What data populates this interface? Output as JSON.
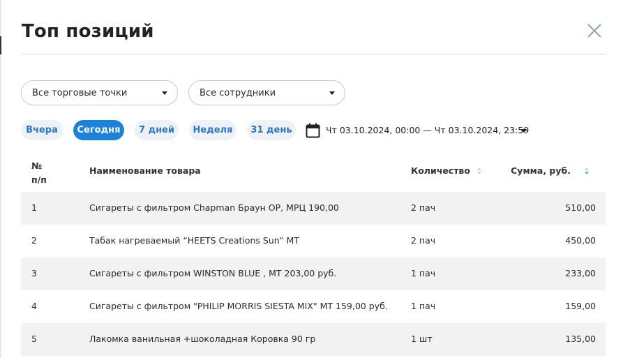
{
  "modal": {
    "title": "Топ позиций"
  },
  "filters": {
    "points_select": "Все торговые точки",
    "staff_select": "Все сотрудники"
  },
  "periods": [
    {
      "label": "Вчера",
      "active": false
    },
    {
      "label": "Сегодня",
      "active": true
    },
    {
      "label": "7 дней",
      "active": false
    },
    {
      "label": "Неделя",
      "active": false
    },
    {
      "label": "31 день",
      "active": false
    }
  ],
  "date_range": {
    "text": "Чт 03.10.2024, 00:00 — Чт 03.10.2024, 23:59"
  },
  "table": {
    "headers": {
      "num_line1": "№",
      "num_line2": "п/п",
      "name": "Наименование товара",
      "qty": "Количество",
      "sum": "Сумма, руб."
    },
    "rows": [
      {
        "num": "1",
        "name": "Сигареты с фильтром Chapman Браун ОР, МРЦ 190,00",
        "qty": "2 пач",
        "sum": "510,00"
      },
      {
        "num": "2",
        "name": "Табак нагреваемый “HEETS Creations Sun” МТ",
        "qty": "2 пач",
        "sum": "450,00"
      },
      {
        "num": "3",
        "name": "Сигареты с фильтром WINSTON BLUE , МТ 203,00 руб.",
        "qty": "1 пач",
        "sum": "233,00"
      },
      {
        "num": "4",
        "name": "Сигареты с фильтром \"PHILIP MORRIS SIESTA MIX\" МТ 159,00 руб.",
        "qty": "1 пач",
        "sum": "159,00"
      },
      {
        "num": "5",
        "name": "Лакомка ванильная +шоколадная Коровка 90 гр",
        "qty": "1 шт",
        "sum": "135,00"
      }
    ]
  },
  "icons": {
    "close": "close-icon",
    "calendar": "calendar-icon",
    "caret": "caret-down-icon",
    "sort": "sort-icon"
  },
  "colors": {
    "accent": "#1a82d9",
    "chip_bg": "#eef2f6",
    "chip_text": "#2a78c8",
    "row_stripe": "#f2f2f2"
  }
}
